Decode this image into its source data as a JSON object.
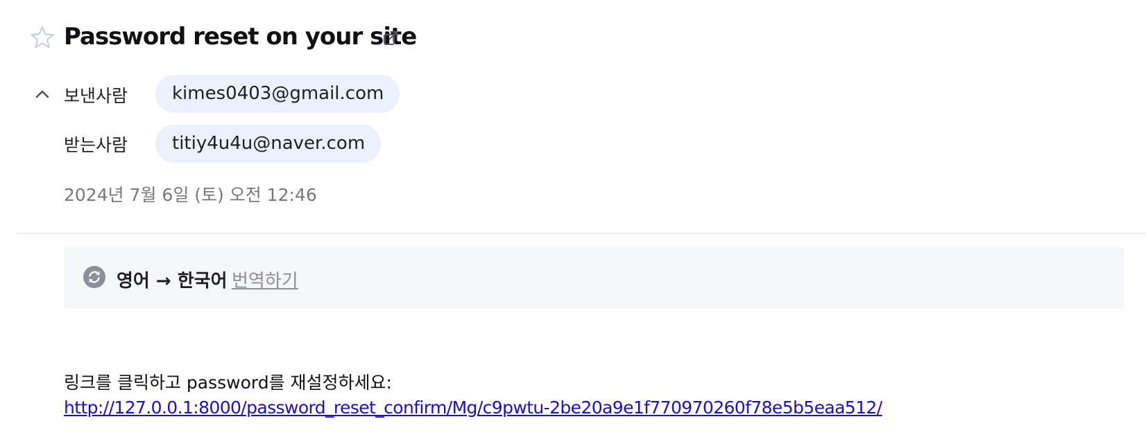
{
  "mail": {
    "subject": "Password reset on your site",
    "from_label": "보낸사람",
    "from_address": "kimes0403@gmail.com",
    "to_label": "받는사람",
    "to_address": "titiy4u4u@naver.com",
    "date": "2024년 7월 6일 (토) 오전 12:46"
  },
  "translate": {
    "pair": "영어 → 한국어",
    "action": "번역하기"
  },
  "body": {
    "text": "링크를 클릭하고 password를 재설정하세요:",
    "link": "http://127.0.0.1:8000/password_reset_confirm/Mg/c9pwtu-2be20a9e1f770970260f78e5b5eaa512/"
  },
  "icons": {
    "star": "star-icon",
    "popout": "external-link-icon",
    "collapse": "chevron-up-icon",
    "translate": "translate-refresh-icon"
  },
  "colors": {
    "chip_bg": "#eaf0fc",
    "link": "#1a0dd6",
    "muted": "#77777d",
    "translate_bg": "#f5f6f8"
  }
}
